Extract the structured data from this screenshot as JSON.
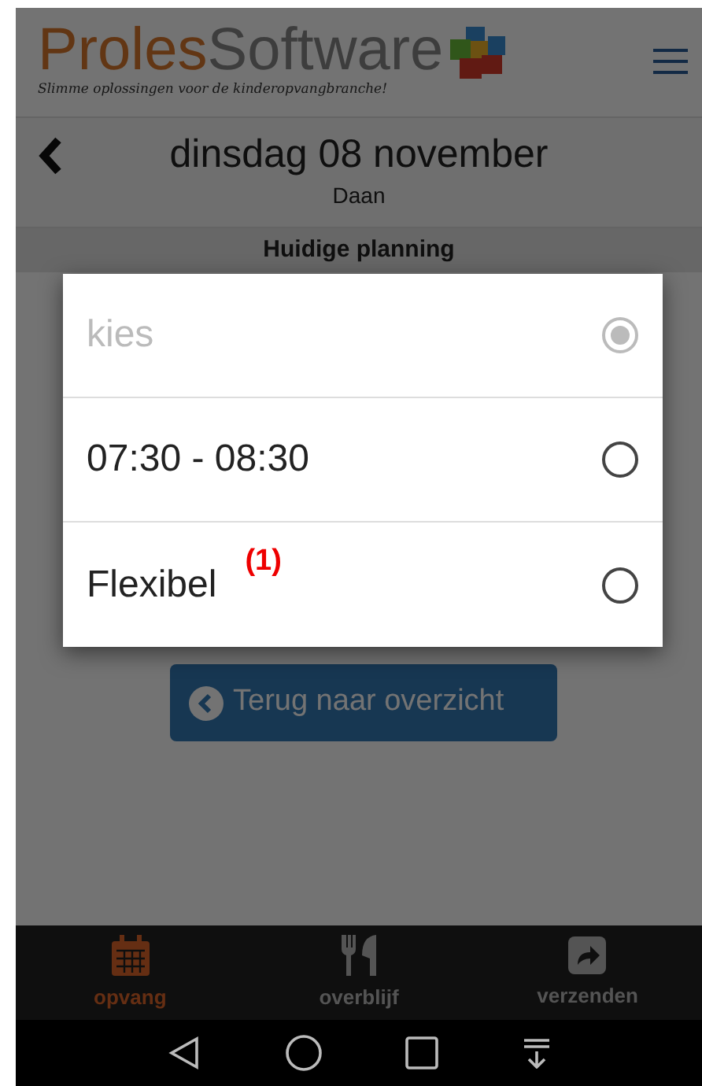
{
  "header": {
    "brand_primary": "Proles",
    "brand_secondary": "Software",
    "tagline": "Slimme oplossingen voor de kinderopvangbranche!"
  },
  "day": {
    "title": "dinsdag 08 november",
    "child": "Daan"
  },
  "section": {
    "title": "Huidige planning"
  },
  "dialog": {
    "options": [
      {
        "label": "kies",
        "selected": true,
        "disabled": true
      },
      {
        "label": "07:30 - 08:30",
        "selected": false,
        "disabled": false
      },
      {
        "label": "Flexibel",
        "selected": false,
        "disabled": false,
        "annotation": "(1)"
      }
    ]
  },
  "back_button": {
    "label": "Terug naar overzicht"
  },
  "bottom_nav": [
    {
      "kind": "calendar",
      "label": "opvang",
      "selected": true
    },
    {
      "kind": "cutlery",
      "label": "overblijf",
      "selected": false
    },
    {
      "kind": "share",
      "label": "verzenden",
      "selected": false
    }
  ]
}
